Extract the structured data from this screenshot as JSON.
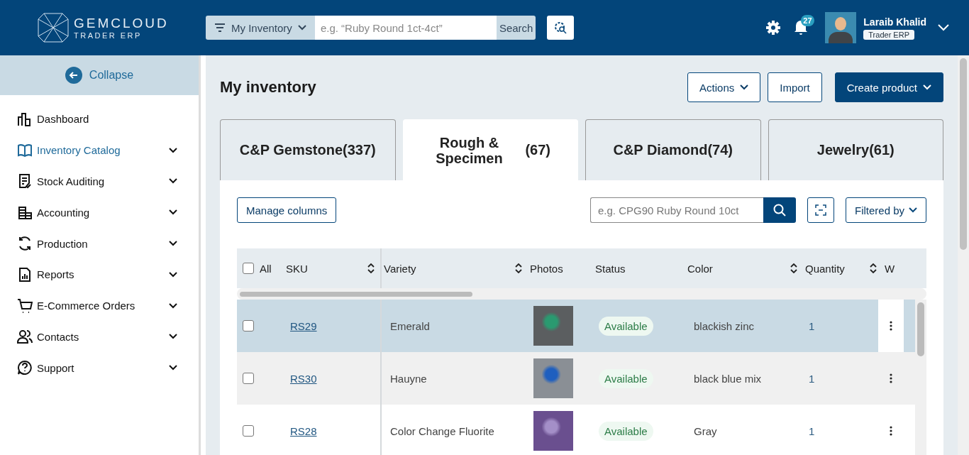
{
  "header": {
    "logo_name": "GEMCLOUD",
    "logo_sub": "TRADER ERP",
    "search_scope": "My Inventory",
    "search_placeholder": "e.g. “Ruby Round 1ct-4ct”",
    "search_button": "Search",
    "notification_count": "27",
    "user_name": "Laraib Khalid",
    "user_role": "Trader ERP"
  },
  "sidebar": {
    "collapse": "Collapse",
    "items": [
      {
        "label": "Dashboard",
        "selected": false,
        "expandable": false
      },
      {
        "label": "Inventory Catalog",
        "selected": true,
        "expandable": true
      },
      {
        "label": "Stock Auditing",
        "selected": false,
        "expandable": true
      },
      {
        "label": "Accounting",
        "selected": false,
        "expandable": true
      },
      {
        "label": "Production",
        "selected": false,
        "expandable": true
      },
      {
        "label": "Reports",
        "selected": false,
        "expandable": true
      },
      {
        "label": "E-Commerce Orders",
        "selected": false,
        "expandable": true
      },
      {
        "label": "Contacts",
        "selected": false,
        "expandable": true
      },
      {
        "label": "Support",
        "selected": false,
        "expandable": true
      }
    ]
  },
  "page": {
    "title": "My inventory",
    "buttons": [
      {
        "label": "Actions",
        "kind": "dropdown"
      },
      {
        "label": "Import",
        "kind": "plain"
      },
      {
        "label": "Create product",
        "kind": "primary"
      }
    ]
  },
  "tabs": [
    {
      "label": "C&P Gemstone(337)",
      "selected": false
    },
    {
      "label": "Rough & Specimen",
      "count": "(67)",
      "selected": true
    },
    {
      "label": "C&P Diamond(74)",
      "selected": false
    },
    {
      "label": "Jewelry(61)",
      "selected": false
    }
  ],
  "toolbar": {
    "manage_columns": "Manage columns",
    "search_placeholder": "e.g. CPG90 Ruby Round 10ct",
    "filter": "Filtered by"
  },
  "table": {
    "select_all": {
      "label": "All",
      "checked": false
    },
    "columns": [
      {
        "label": "SKU",
        "sortable": true
      },
      {
        "label": "Variety",
        "sortable": true
      },
      {
        "label": "Photos",
        "sortable": false
      },
      {
        "label": "Status",
        "sortable": false
      },
      {
        "label": "Color",
        "sortable": true
      },
      {
        "label": "Quantity",
        "sortable": true
      },
      {
        "label": "W",
        "sortable": false
      }
    ],
    "rows": [
      {
        "sku": "RS29",
        "variety": "Emerald",
        "status": "Available",
        "color_name": "blackish zinc",
        "quantity": "1",
        "checked": false,
        "selected": true
      },
      {
        "sku": "RS30",
        "variety": "Hauyne",
        "status": "Available",
        "color_name": "black blue mix",
        "quantity": "1",
        "checked": false,
        "selected": false
      },
      {
        "sku": "RS28",
        "variety": "Color Change Fluorite",
        "status": "Available",
        "color_name": "Gray",
        "quantity": "1",
        "checked": false,
        "selected": false
      }
    ]
  }
}
